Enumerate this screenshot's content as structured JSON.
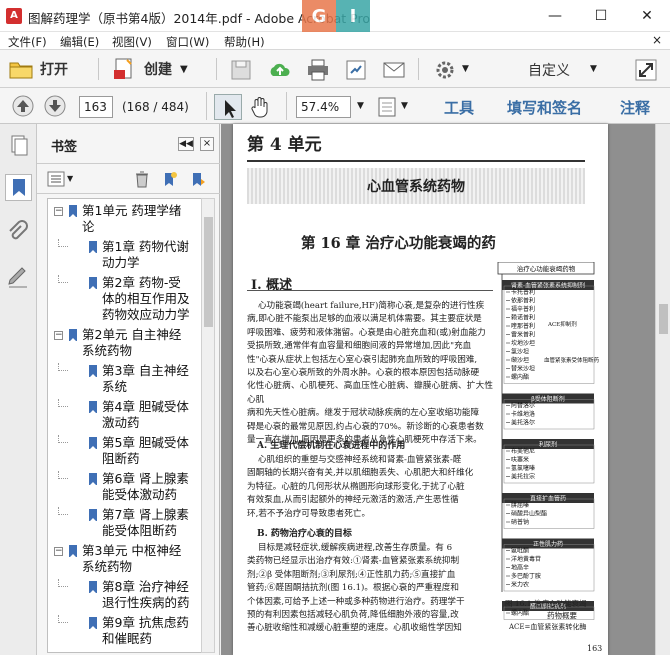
{
  "window": {
    "title": "图解药理学（原书第4版）2014年.pdf - Adobe Acrobat Pro",
    "watermark_left": "G",
    "watermark_right": "I",
    "minimize_glyph": "—",
    "maximize_glyph": "☐",
    "close_glyph": "✕"
  },
  "menu": {
    "items": [
      "文件(F)",
      "编辑(E)",
      "视图(V)",
      "窗口(W)",
      "帮助(H)"
    ],
    "close_glyph": "×"
  },
  "toolbar": {
    "open_label": "打开",
    "create_label": "创建",
    "customize_label": "自定义"
  },
  "navbar": {
    "current_page": "163",
    "page_count": "(168 / 484)",
    "zoom": "57.4%",
    "tools_label": "工具",
    "sign_label": "填写和签名",
    "comment_label": "注释"
  },
  "bookmarks": {
    "title": "书签",
    "items": [
      {
        "level": 0,
        "lines": [
          "第1单元  药理学绪",
          "论"
        ]
      },
      {
        "level": 1,
        "lines": [
          "第1章  药物代谢",
          "动力学"
        ]
      },
      {
        "level": 1,
        "lines": [
          "第2章  药物-受",
          "体的相互作用及",
          "药物效应动力学"
        ]
      },
      {
        "level": 0,
        "lines": [
          "第2单元  自主神经",
          "系统药物"
        ]
      },
      {
        "level": 1,
        "lines": [
          "第3章  自主神经",
          "系统"
        ]
      },
      {
        "level": 1,
        "lines": [
          "第4章  胆碱受体",
          "激动药"
        ]
      },
      {
        "level": 1,
        "lines": [
          "第5章  胆碱受体",
          "阻断药"
        ]
      },
      {
        "level": 1,
        "lines": [
          "第6章  肾上腺素",
          "能受体激动药"
        ]
      },
      {
        "level": 1,
        "lines": [
          "第7章  肾上腺素",
          "能受体阻断药"
        ]
      },
      {
        "level": 0,
        "lines": [
          "第3单元  中枢神经",
          "系统药物"
        ]
      },
      {
        "level": 1,
        "lines": [
          "第8章  治疗神经",
          "退行性疾病的药"
        ]
      },
      {
        "level": 1,
        "lines": [
          "第9章  抗焦虑药",
          "和催眠药"
        ]
      }
    ]
  },
  "page": {
    "unit_title": "第 4 单元",
    "banner": "心血管系统药物",
    "chapter": "第 16 章    治疗心功能衰竭的药",
    "section": "Ⅰ. 概述",
    "para1": "    心功能衰竭(heart failure,HF)简称心衰,是复杂的进行性疾\n病,即心脏不能泵出足够的血液以满足机体需要。其主要症状是\n呼吸困难、疲劳和液体潴留。心衰是由心脏充血和(或)射血能力\n受损所致,通常伴有血容量和细胞间液的异常增加,因此\"充血\n性\"心衰从症状上包括左心室心衰引起肺充血所致的呼吸困难,\n以及右心室心衰所致的外周水肿。心衰的根本原因包括动脉硬\n化性心脏病、心肌梗死、高血压性心脏病、瓣膜心脏病、扩大性心肌\n病和先天性心脏病。继发于冠状动脉疾病的左心室收缩功能障\n碍是心衰的最常见原因,约占心衰的70%。新诊断的心衰患者数\n量一直在增加,原因是更多的患者从急性心肌梗死中存活下来。",
    "subhead_a": "A. 生理代偿机制在心衰进程中的作用",
    "para2": "    心肌组织的重塑与交感神经系统和肾素-血管紧张素-醛\n固酮轴的长期兴奋有关,并以肌细胞丢失、心肌肥大和纤维化\n为特征。心脏的几何形状从椭圆形向球形变化,于扰了心脏\n有效泵血,从而引起额外的神经元激活的激活,产生恶性循\n环,若不予治疗可导致患者死亡。",
    "subhead_b": "B. 药物治疗心衰的目标",
    "para3": "    目标是减轻症状,缓解疾病进程,改善生存质量。有 6\n类药物已经显示出治疗有效:①肾素-血管紧张素系统抑制\n剂;②β 受体阻断剂;③利尿剂;④正性肌力药;⑤直接扩血\n管药;⑥醛固酮拮抗剂(图 16.1)。根据心衰的严重程度和\n个体因素,可给予上述一种或多种药物进行治疗。药理学干\n预的有利因素包括减轻心肌负荷,降低细胞外液的容量,改\n善心脏收缩性和减缓心脏重塑的速度。心肌收缩性学因知",
    "page_number": "163",
    "diagram": {
      "title": "治疗心功能衰竭药物",
      "groups": [
        {
          "header": "肾素-血管紧张素系统抑制剂",
          "items": [
            "卡托普利",
            "依那普利",
            "福辛普利",
            "赖诺普利",
            "喹那普利",
            "雷米普利",
            "坎地沙坦",
            "氯沙坦",
            "缬沙坦",
            "替米沙坦",
            "螺内酯"
          ],
          "notes": [
            "ACE抑制剂",
            "血管紧张素受体阻断药"
          ]
        },
        {
          "header": "β受体阻断剂",
          "items": [
            "阿替洛尔",
            "卡维地洛",
            "美托洛尔"
          ]
        },
        {
          "header": "利尿剂",
          "items": [
            "布美他尼",
            "呋塞米",
            "氢氯噻嗪",
            "美托拉宗"
          ]
        },
        {
          "header": "直接扩血管药",
          "items": [
            "肼屈嗪",
            "硝酸异山梨酯",
            "硝普钠"
          ]
        },
        {
          "header": "正性肌力药",
          "items": [
            "氨吡酮",
            "洋地黄毒苷",
            "地高辛",
            "多巴酚丁胺",
            "米力农"
          ]
        },
        {
          "header": "醛固酮拮抗剂",
          "items": [
            "螺内酯"
          ]
        }
      ],
      "caption": "图 16.1    治疗心功能衰竭",
      "caption2": "药物概要",
      "abbr": "ACE=血管紧张素转化酶"
    }
  },
  "colors": {
    "link_blue": "#3a6ea5",
    "bookmark_blue": "#3f6fb5",
    "acrobat_red": "#d32f2f"
  }
}
